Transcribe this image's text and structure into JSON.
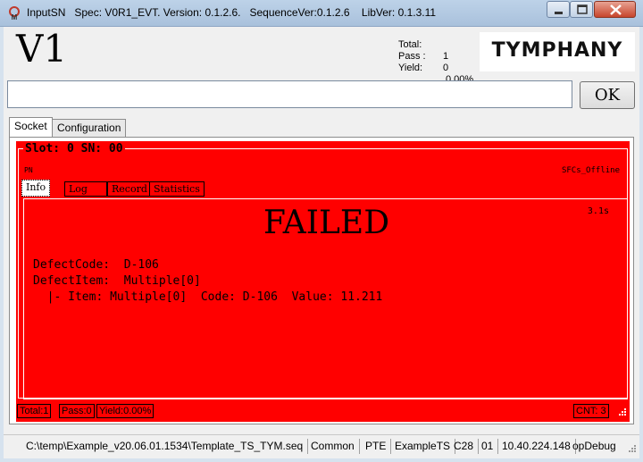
{
  "window": {
    "title": "InputSN   Spec: V0R1_EVT. Version: 0.1.2.6.   SequenceVer:0.1.2.6    LibVer: 0.1.3.11"
  },
  "header": {
    "station": "V1",
    "stats": [
      {
        "label": "Total:",
        "value": "1"
      },
      {
        "label": "Pass :",
        "value": "0"
      },
      {
        "label": "Yield:",
        "value": "0.00%"
      }
    ],
    "logo": "TYMPHANY"
  },
  "sn_input": {
    "value": "",
    "placeholder": ""
  },
  "ok_button": {
    "label": "OK"
  },
  "tabs": [
    {
      "label": "Socket",
      "active": true
    },
    {
      "label": "Configuration",
      "active": false
    }
  ],
  "socket": {
    "slot_title": "Slot: 0 SN: 00",
    "pn_label": "PN",
    "mode": "SFCs_Offline",
    "subtabs": [
      "Info",
      "Log",
      "Record",
      "Statistics"
    ],
    "elapsed": "3.1s",
    "result": "FAILED",
    "defect_code": "DefectCode:  D-106",
    "defect_item": "DefectItem:  Multiple[0]",
    "item_line": "  |- Item: Multiple[0]  Code: D-106  Value: 11.211",
    "status": {
      "total": "Total:1",
      "pass": "Pass:0",
      "yield": "Yield:0.00%",
      "cnt": "CNT: 3"
    },
    "color": "#ff0000"
  },
  "statusbar": {
    "items": [
      "C:\\temp\\Example_v20.06.01.1534\\Template_TS_TYM.seq",
      "Common",
      "PTE",
      "ExampleTS",
      "C28",
      "01",
      "10.40.224.148",
      "opDebug"
    ]
  }
}
